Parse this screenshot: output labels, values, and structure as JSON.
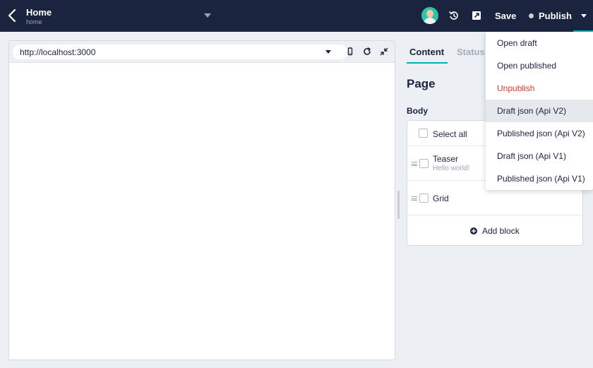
{
  "header": {
    "title": "Home",
    "slug": "home",
    "save_label": "Save",
    "publish_label": "Publish"
  },
  "preview": {
    "url": "http://localhost:3000"
  },
  "tabs": [
    {
      "label": "Content"
    },
    {
      "label": "Status"
    }
  ],
  "page_heading": "Page",
  "body_label": "Body",
  "blocks": {
    "select_all_label": "Select all",
    "items": [
      {
        "label": "Teaser",
        "subtitle": "Hello world!"
      },
      {
        "label": "Grid",
        "subtitle": ""
      }
    ],
    "add_label": "Add block"
  },
  "dropdown": {
    "items": [
      {
        "label": "Open draft"
      },
      {
        "label": "Open published"
      },
      {
        "label": "Unpublish"
      },
      {
        "label": "Draft json (Api V2)"
      },
      {
        "label": "Published json (Api V2)"
      },
      {
        "label": "Draft json (Api V1)"
      },
      {
        "label": "Published json (Api V1)"
      }
    ]
  },
  "colors": {
    "topbar": "#1b243f",
    "accent": "#00b3b0",
    "danger": "#e0382c"
  },
  "icons": [
    "back-arrow-icon",
    "chevron-down-icon",
    "history-icon",
    "external-link-icon",
    "mobile-icon",
    "reload-icon",
    "collapse-icon",
    "drag-handle-icon",
    "plus-circle-icon"
  ]
}
